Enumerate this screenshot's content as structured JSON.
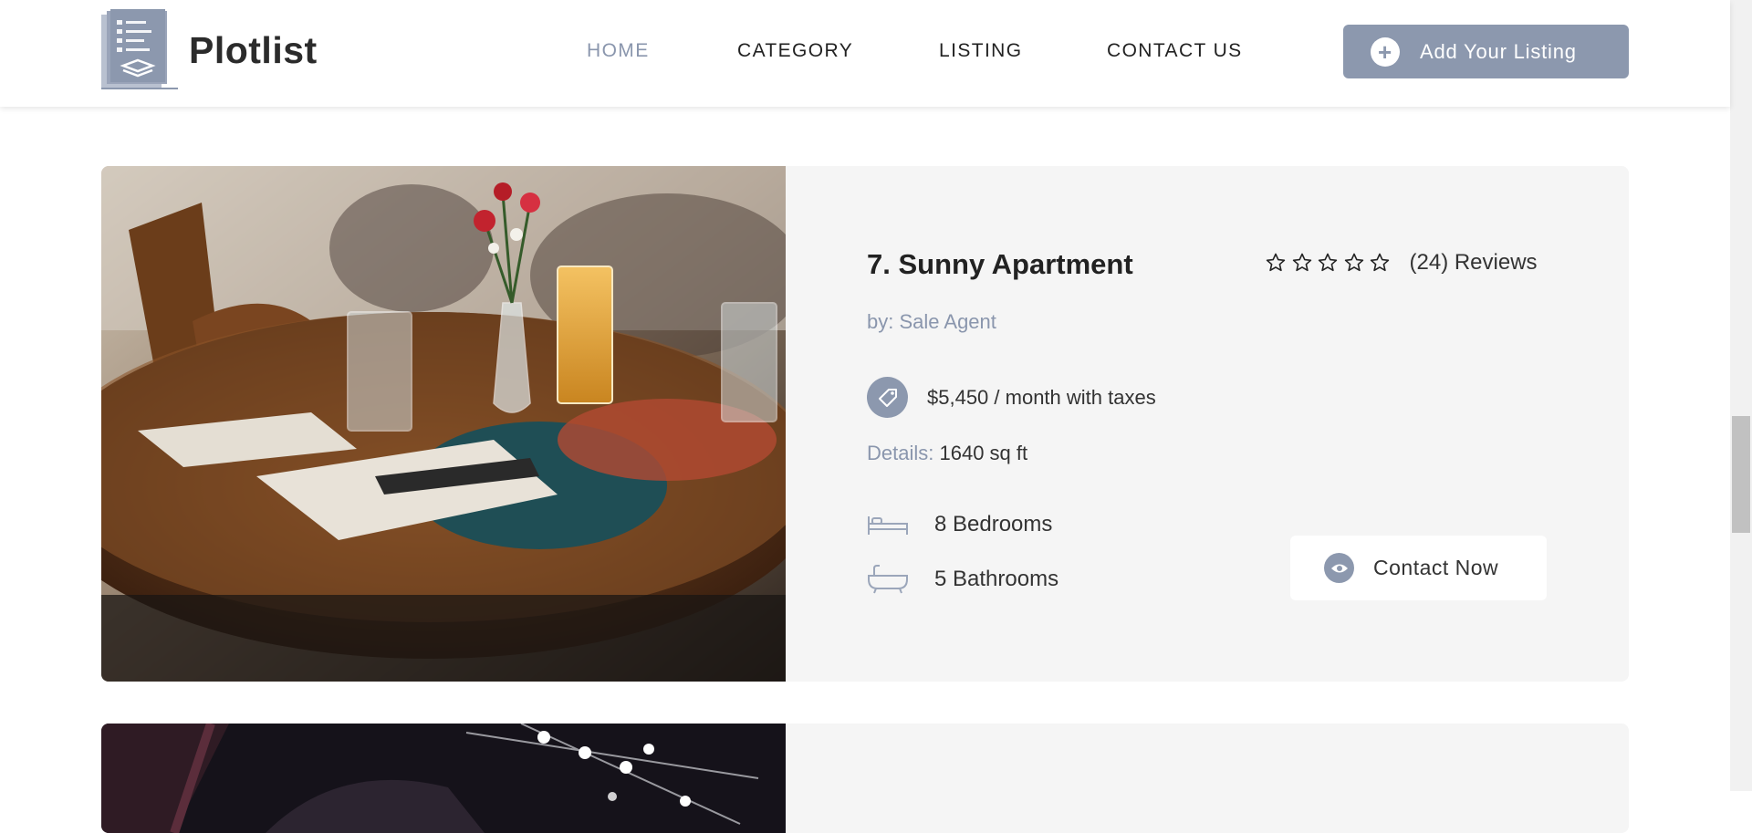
{
  "brand": {
    "name": "Plotlist"
  },
  "nav": {
    "items": [
      {
        "label": "HOME",
        "active": true
      },
      {
        "label": "CATEGORY",
        "active": false
      },
      {
        "label": "LISTING",
        "active": false
      },
      {
        "label": "CONTACT US",
        "active": false
      }
    ],
    "cta_label": "Add Your Listing",
    "cta_icon": "plus-icon"
  },
  "listing": {
    "title": "7. Sunny Apartment",
    "rating_stars": 0,
    "rating_max": 5,
    "reviews": "(24) Reviews",
    "agent": "by: Sale Agent",
    "price": "$5,450 / month with taxes",
    "details_label": "Details:",
    "details_value": "1640 sq ft",
    "bedrooms": "8 Bedrooms",
    "bathrooms": "5 Bathrooms",
    "contact_label": "Contact Now",
    "image_subject": "cafe table with glasses, vase of flowers and menu"
  },
  "colors": {
    "accent": "#8c98ae",
    "accent_text": "#8a96ad",
    "card_bg": "#f5f5f5",
    "text": "#222222"
  }
}
